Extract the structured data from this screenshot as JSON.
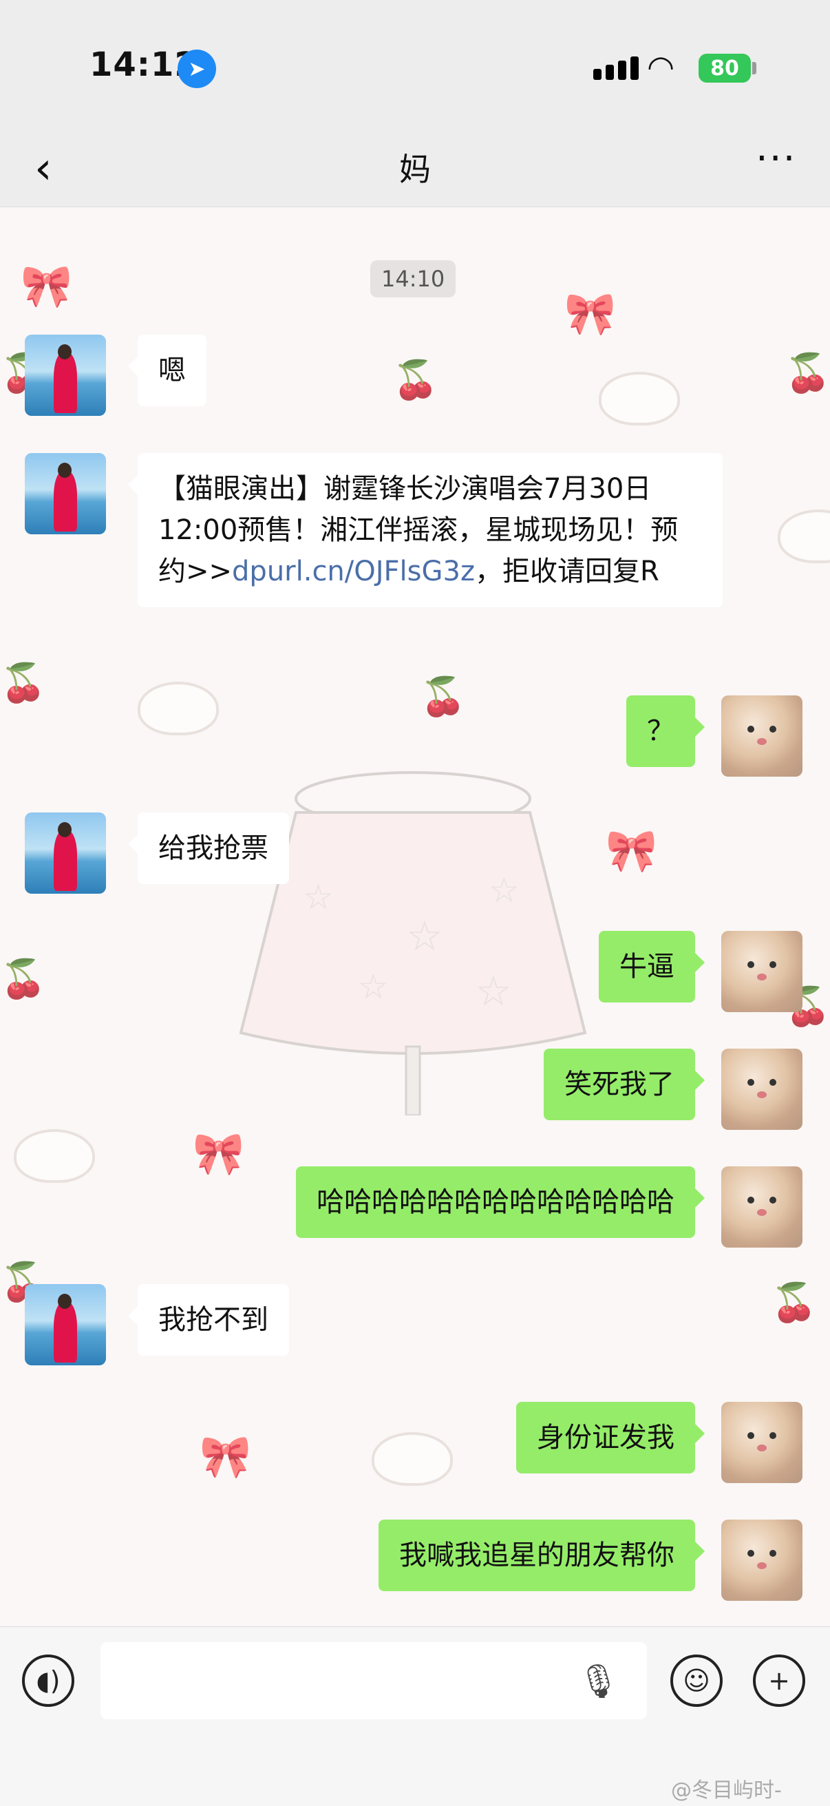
{
  "status_bar": {
    "time": "14:12",
    "battery": "80"
  },
  "nav": {
    "title": "妈"
  },
  "chat": {
    "timestamp": "14:10",
    "messages": [
      {
        "side": "left",
        "text": "嗯"
      },
      {
        "side": "left",
        "text_main": "【猫眼演出】谢霆锋长沙演唱会7月30日12:00预售！湘江伴摇滚，星城现场见！预约>>",
        "link": "dpurl.cn/OJFlsG3z",
        "text_tail": "，拒收请回复R"
      },
      {
        "side": "right",
        "text": "？"
      },
      {
        "side": "left",
        "text": "给我抢票"
      },
      {
        "side": "right",
        "text": "牛逼"
      },
      {
        "side": "right",
        "text": "笑死我了"
      },
      {
        "side": "right",
        "text": "哈哈哈哈哈哈哈哈哈哈哈哈哈"
      },
      {
        "side": "left",
        "text": "我抢不到"
      },
      {
        "side": "right",
        "text": "身份证发我"
      },
      {
        "side": "right",
        "text": "我喊我追星的朋友帮你"
      }
    ]
  },
  "watermark": "@冬目屿时-",
  "icons": [
    "location-arrow-icon",
    "signal-icon",
    "wifi-icon",
    "battery-icon",
    "back-icon",
    "more-icon",
    "voice-icon",
    "microphone-icon",
    "emoji-icon",
    "plus-icon"
  ]
}
